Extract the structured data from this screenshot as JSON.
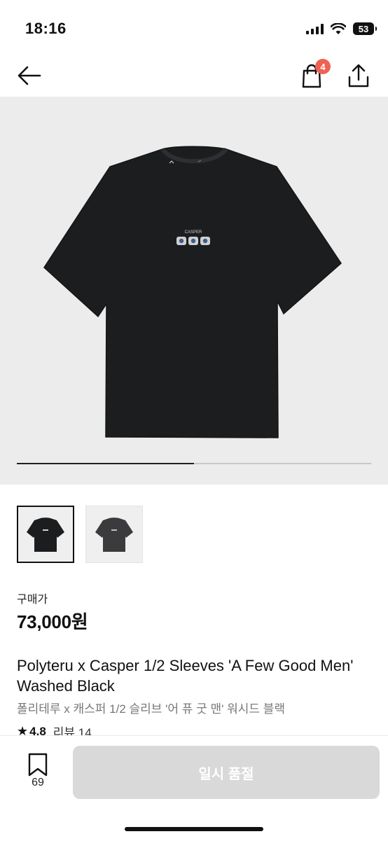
{
  "status_bar": {
    "time": "18:16",
    "battery": "53"
  },
  "header": {
    "cart_count": "4"
  },
  "hero": {
    "image_index": 0,
    "image_count": 2,
    "progress": 0.5,
    "print_text": "CASPER"
  },
  "thumbnails": [
    {
      "color": "#1c1d1f",
      "selected": true
    },
    {
      "color": "#3b3b3d",
      "selected": false
    }
  ],
  "product": {
    "price_label": "구매가",
    "price": "73,000원",
    "title_en": "Polyteru x Casper 1/2 Sleeves 'A Few Good Men' Washed Black",
    "title_ko": "폴리테루 x 캐스퍼 1/2 슬리브 '어 퓨 굿 맨' 워시드 블랙",
    "rating": "4.8",
    "reviews": "리뷰 14"
  },
  "bottom_bar": {
    "save_count": "69",
    "buy_label": "일시 품절"
  },
  "colors": {
    "badge": "#ef6253",
    "disabled_button": "#d9d9d9",
    "hero_bg": "#ececec"
  }
}
